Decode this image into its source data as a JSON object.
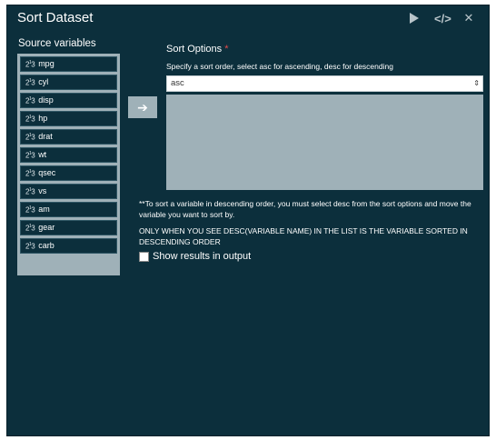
{
  "dialog": {
    "title": "Sort Dataset",
    "header_icons": [
      "play-icon",
      "code-icon",
      "close-icon"
    ],
    "code_glyph": "</>",
    "close_glyph": "✕"
  },
  "source": {
    "label": "Source variables",
    "items": [
      {
        "type_icon": "numeric",
        "name": "mpg"
      },
      {
        "type_icon": "numeric",
        "name": "cyl"
      },
      {
        "type_icon": "numeric",
        "name": "disp"
      },
      {
        "type_icon": "numeric",
        "name": "hp"
      },
      {
        "type_icon": "numeric",
        "name": "drat"
      },
      {
        "type_icon": "numeric",
        "name": "wt"
      },
      {
        "type_icon": "numeric",
        "name": "qsec"
      },
      {
        "type_icon": "numeric",
        "name": "vs"
      },
      {
        "type_icon": "numeric",
        "name": "am"
      },
      {
        "type_icon": "numeric",
        "name": "gear"
      },
      {
        "type_icon": "numeric",
        "name": "carb"
      }
    ]
  },
  "move_button": {
    "glyph": "➔"
  },
  "sort_options": {
    "label": "Sort Options",
    "required_mark": "*",
    "help": "Specify a sort order, select asc for ascending, desc for descending",
    "selected": "asc",
    "list_items": []
  },
  "notes": {
    "line1": "**To sort a variable in descending order, you must select desc from the sort options and move the variable you want to sort by.",
    "line2": "ONLY WHEN YOU SEE DESC(VARIABLE NAME) IN THE LIST IS THE VARIABLE SORTED IN DESCENDING ORDER"
  },
  "show_results": {
    "label": "Show results in output",
    "checked": false
  },
  "colors": {
    "panel": "#0c2f3c",
    "list_bg": "#9fb1b8",
    "required": "#e34b4b"
  }
}
